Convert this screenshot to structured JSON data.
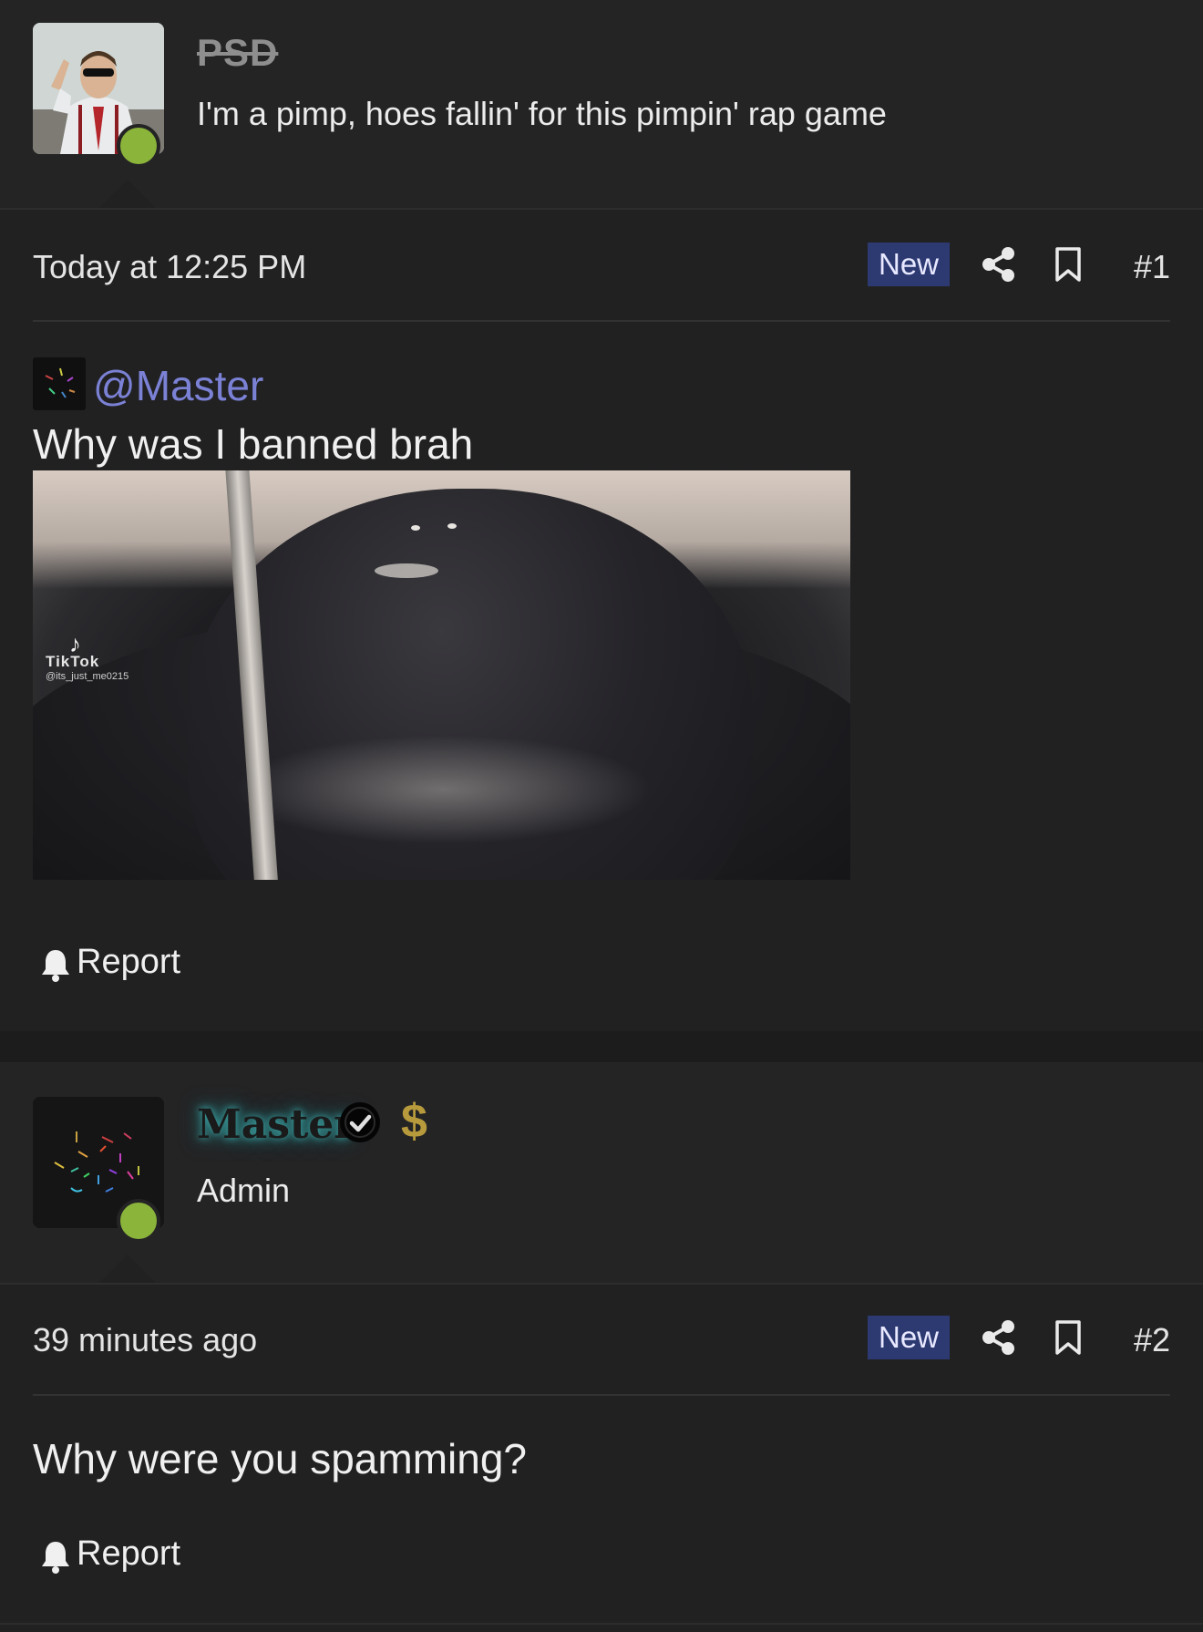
{
  "colors": {
    "background": "#212122",
    "online": "#8bb43a",
    "badge": "#2d3a72",
    "mention": "#7b82d6",
    "text": "#f0f0f0"
  },
  "posts": [
    {
      "username": "PSD",
      "user_title": "I'm a pimp, hoes fallin' for this pimpin' rap game",
      "time": "Today at 12:25 PM",
      "badge": "New",
      "number": "#1",
      "mention": "@Master",
      "text": "Why was I banned brah",
      "gif_watermark": "TikTok",
      "gif_handle": "@its_just_me0215",
      "report_label": "Report"
    },
    {
      "username": "Master",
      "user_title": "Admin",
      "time": "39 minutes ago",
      "badge": "New",
      "number": "#2",
      "text": "Why were you spamming?",
      "report_label": "Report"
    }
  ],
  "icons": {
    "share": "share-icon",
    "bookmark": "bookmark-icon",
    "report": "bell-icon",
    "verified": "verified-check-icon",
    "currency": "dollar-icon"
  }
}
